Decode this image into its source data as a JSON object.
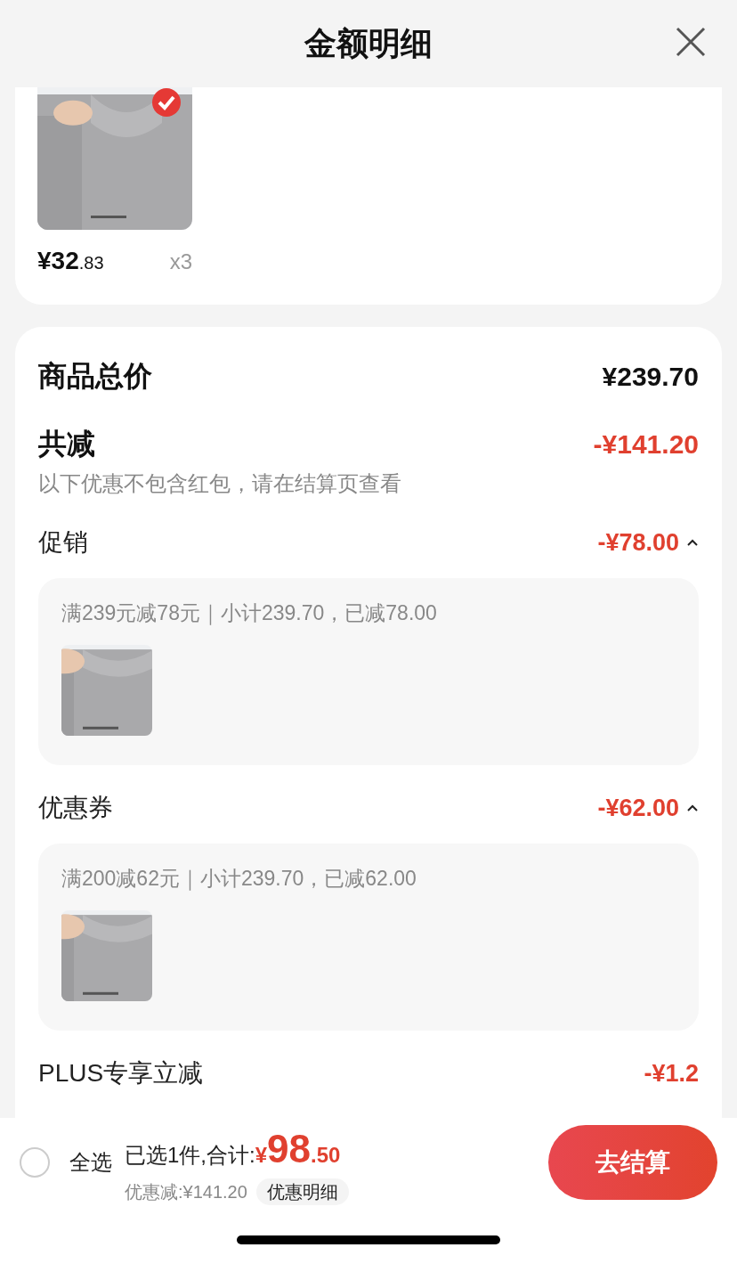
{
  "header": {
    "title": "金额明细"
  },
  "product": {
    "checked": true,
    "price_main": "¥32",
    "price_fraction": ".83",
    "quantity": "x3"
  },
  "summary": {
    "total_label": "商品总价",
    "total_value": "¥239.70",
    "discount_label": "共减",
    "discount_value": "-¥141.20",
    "note": "以下优惠不包含红包，请在结算页查看"
  },
  "sections": [
    {
      "label": "促销",
      "value": "-¥78.00",
      "expanded": true,
      "detail": "满239元减78元｜小计239.70，已减78.00"
    },
    {
      "label": "优惠券",
      "value": "-¥62.00",
      "expanded": true,
      "detail": "满200减62元｜小计239.70，已减62.00"
    },
    {
      "label": "PLUS专享立减",
      "value": "-¥1.2"
    }
  ],
  "bottom_bar": {
    "select_all_checked": false,
    "select_all_label": "全选",
    "selected_text": "已选1件,合计:",
    "currency": "¥",
    "total_main": "98",
    "total_fraction": ".50",
    "discount_text": "优惠减:¥141.20",
    "detail_link": "优惠明细",
    "checkout": "去结算"
  }
}
